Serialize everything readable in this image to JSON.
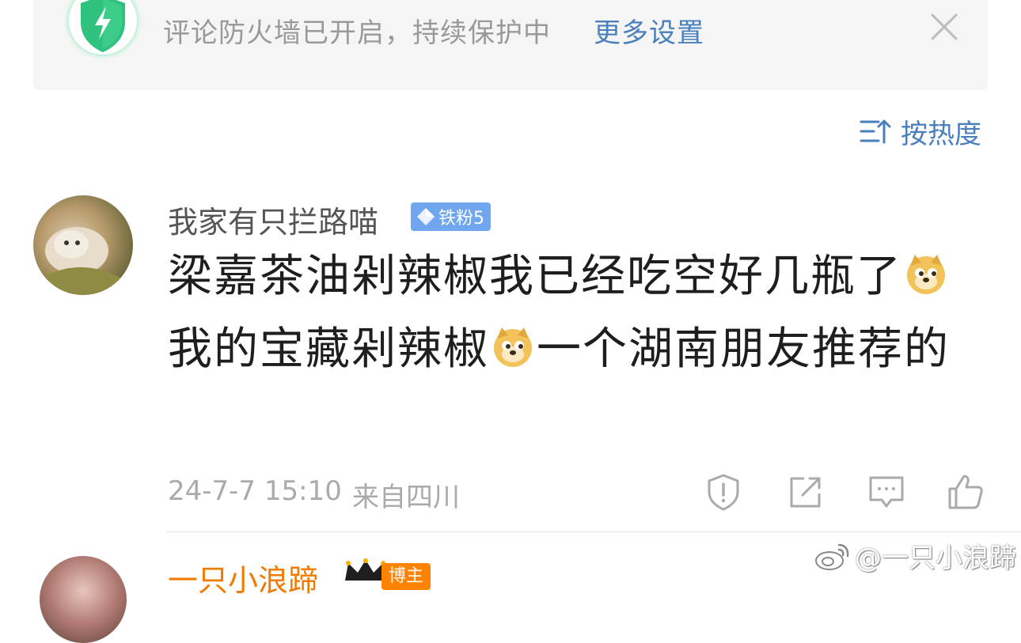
{
  "banner": {
    "text": "评论防火墙已开启，持续保护中",
    "link": "更多设置",
    "icon": "shield-lightning-icon",
    "shield_color": "#3ecf8e"
  },
  "sort": {
    "label": "按热度",
    "icon": "sort-icon"
  },
  "comment": {
    "username": "我家有只拦路喵",
    "badge": "铁粉5",
    "text_parts": [
      "梁嘉茶油剁辣椒我已经吃空好几瓶了",
      "我的宝藏剁辣椒",
      "一个湖南朋友推荐的"
    ],
    "time": "24-7-7 15:10",
    "location": "来自四川",
    "actions": [
      "report-icon",
      "share-icon",
      "comment-icon",
      "like-icon"
    ]
  },
  "next_comment": {
    "username": "一只小浪蹄",
    "badge": "博主"
  },
  "watermark": "@一只小浪蹄",
  "colors": {
    "link": "#4a7fbd",
    "muted": "#aaaaaa",
    "badge_blue": "#6fa6ef",
    "host_orange": "#ff8200"
  }
}
